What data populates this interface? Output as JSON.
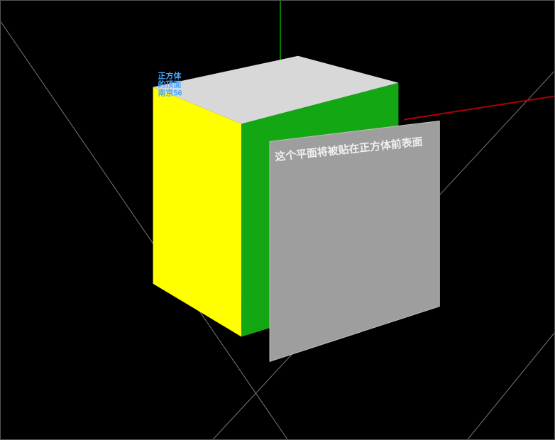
{
  "scene": {
    "axes": {
      "x_color": "#b00000",
      "y_color": "#008000",
      "z_color": "#0000cc"
    },
    "cube": {
      "top_color": "#d8d8d8",
      "left_color": "#ffff00",
      "front_color": "#14a714",
      "top_label_line1": "正方体",
      "top_label_line2": "的顶面",
      "top_label_line3": "南京56"
    },
    "plane": {
      "label": "这个平面将被贴在正方体前表面",
      "color": "#9e9e9e"
    }
  }
}
